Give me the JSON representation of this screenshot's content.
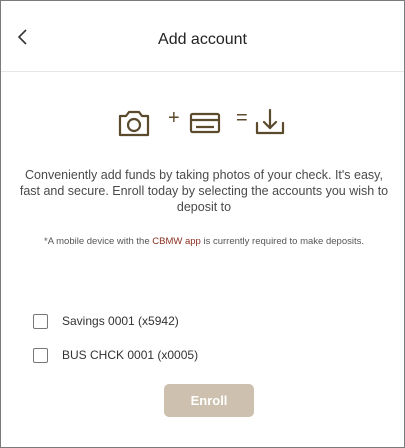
{
  "header": {
    "title": "Add account"
  },
  "illustration": {
    "icons": [
      "camera-icon",
      "check-card-icon",
      "download-icon"
    ],
    "plus": "+",
    "equals": "=",
    "color": "#5b4a2c"
  },
  "description": "Conveniently add funds by taking photos of your check. It's easy, fast and secure. Enroll today by selecting the accounts you wish to deposit to",
  "note": {
    "prefix": "*A mobile device with the ",
    "link": "CBMW app",
    "suffix": " is currently required to make deposits."
  },
  "accounts": [
    {
      "label": "Savings 0001 (x5942)",
      "checked": false
    },
    {
      "label": "BUS CHCK 0001 (x0005)",
      "checked": false
    }
  ],
  "enroll_button": {
    "label": "Enroll",
    "enabled": false,
    "color": "#cdc0ae"
  },
  "colors": {
    "accent": "#8b2d1f",
    "icon": "#5b4a2c"
  }
}
